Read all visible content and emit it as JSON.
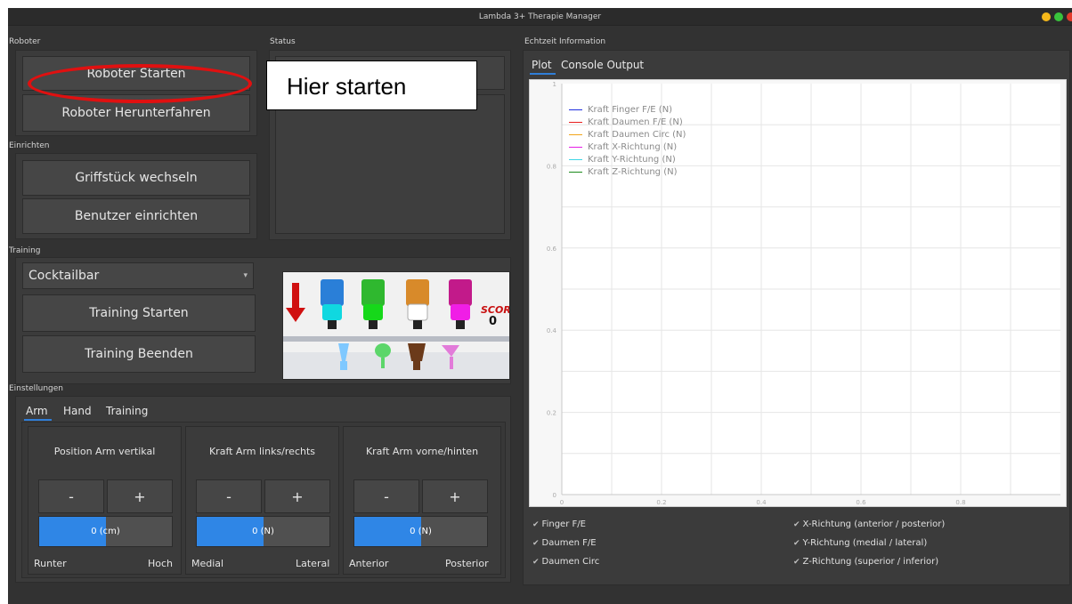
{
  "window": {
    "title": "Lambda 3+ Therapie Manager"
  },
  "annotation": {
    "callout_text": "Hier starten"
  },
  "sections": {
    "roboter": "Roboter",
    "status": "Status",
    "echtzeit": "Echtzeit Information",
    "einrichten": "Einrichten",
    "training": "Training",
    "einstellungen": "Einstellungen"
  },
  "roboter": {
    "start": "Roboter Starten",
    "shutdown": "Roboter Herunterfahren"
  },
  "einrichten": {
    "change_grip": "Griffstück wechseln",
    "setup_user": "Benutzer einrichten"
  },
  "training": {
    "selected_game": "Cocktailbar",
    "start": "Training Starten",
    "stop": "Training Beenden",
    "game_score_label": "SCORE",
    "game_score_value": "0"
  },
  "einstellungen": {
    "tabs": [
      "Arm",
      "Hand",
      "Training"
    ],
    "active_tab": "Arm",
    "columns": [
      {
        "title": "Position Arm vertikal",
        "minus": "-",
        "plus": "+",
        "value": "0 (cm)",
        "fill_fraction": 0.5,
        "left_label": "Runter",
        "right_label": "Hoch"
      },
      {
        "title": "Kraft Arm links/rechts",
        "minus": "-",
        "plus": "+",
        "value": "0 (N)",
        "fill_fraction": 0.5,
        "left_label": "Medial",
        "right_label": "Lateral"
      },
      {
        "title": "Kraft Arm vorne/hinten",
        "minus": "-",
        "plus": "+",
        "value": "0 (N)",
        "fill_fraction": 0.5,
        "left_label": "Anterior",
        "right_label": "Posterior"
      }
    ]
  },
  "echtzeit": {
    "tabs": [
      "Plot",
      "Console Output"
    ],
    "active_tab": "Plot",
    "checkboxes_left": [
      "Finger F/E",
      "Daumen F/E",
      "Daumen Circ"
    ],
    "checkboxes_right": [
      "X-Richtung (anterior / posterior)",
      "Y-Richtung (medial / lateral)",
      "Z-Richtung (superior / inferior)"
    ],
    "check_mark": "✔"
  },
  "chart_data": {
    "type": "line",
    "title": "",
    "xlabel": "",
    "ylabel": "",
    "xlim": [
      0,
      1
    ],
    "ylim": [
      0,
      1
    ],
    "x_ticks": [
      "0",
      "0.2",
      "0.4",
      "0.6",
      "0.8"
    ],
    "y_ticks": [
      "0",
      "0.2",
      "0.4",
      "0.6",
      "0.8",
      "1"
    ],
    "grid": true,
    "legend_position": "top-left",
    "series": [
      {
        "name": "Kraft Finger F/E (N)",
        "color": "#1f2fe0",
        "values": []
      },
      {
        "name": "Kraft Daumen F/E (N)",
        "color": "#e81d1d",
        "values": []
      },
      {
        "name": "Kraft Daumen Circ (N)",
        "color": "#f2a51a",
        "values": []
      },
      {
        "name": "Kraft X-Richtung (N)",
        "color": "#e61ee6",
        "values": []
      },
      {
        "name": "Kraft Y-Richtung (N)",
        "color": "#3fd6e6",
        "values": []
      },
      {
        "name": "Kraft Z-Richtung (N)",
        "color": "#1b8a1b",
        "values": []
      }
    ]
  },
  "colors": {
    "accent": "#2f86e6",
    "annotation_ring": "#e01010",
    "window_bg": "#323232"
  }
}
